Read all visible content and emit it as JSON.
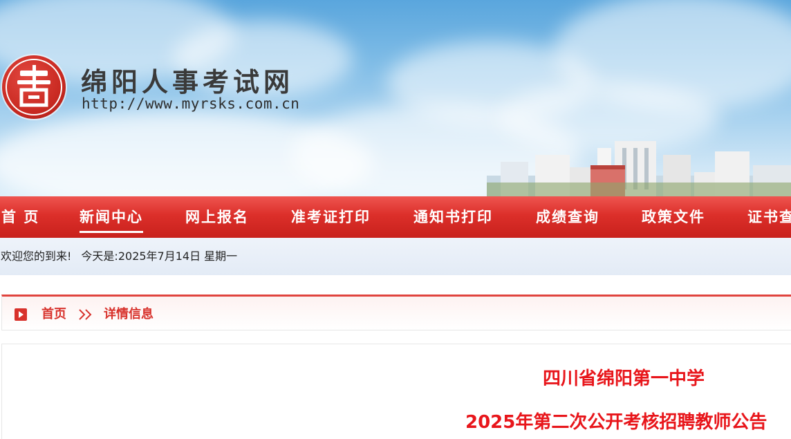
{
  "header": {
    "site_title": "绵阳人事考试网",
    "site_url": "http://www.myrsks.com.cn"
  },
  "nav": {
    "items": [
      {
        "label": "首 页"
      },
      {
        "label": "新闻中心",
        "active": true
      },
      {
        "label": "网上报名"
      },
      {
        "label": "准考证打印"
      },
      {
        "label": "通知书打印"
      },
      {
        "label": "成绩查询"
      },
      {
        "label": "政策文件"
      },
      {
        "label": "证书查"
      }
    ]
  },
  "welcome": {
    "greeting": "欢迎您的到来!",
    "date_label": "今天是:",
    "date_value": "2025年7月14日 星期一"
  },
  "breadcrumb": {
    "home": "首页",
    "separator": ">>",
    "current": "详情信息"
  },
  "article": {
    "title_line1": "四川省绵阳第一中学",
    "title_line2": "2025年第二次公开考核招聘教师公告"
  },
  "colors": {
    "nav_red": "#dc2f2a",
    "title_red": "#e8161b",
    "crumb_red": "#d8322c"
  }
}
